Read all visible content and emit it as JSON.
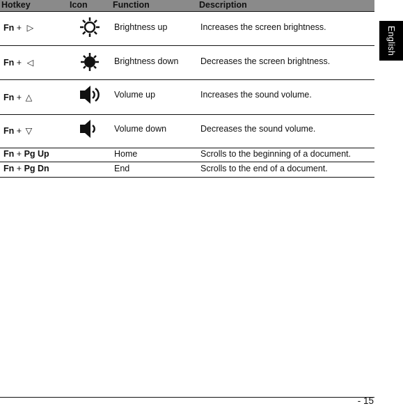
{
  "table": {
    "headers": {
      "hotkey": "Hotkey",
      "icon": "Icon",
      "function": "Function",
      "description": "Description"
    },
    "rows": [
      {
        "key": "Fn",
        "plus": "+",
        "key2": "▷",
        "icon": "brightness-up-icon",
        "function": "Brightness up",
        "description": "Increases the screen brightness."
      },
      {
        "key": "Fn",
        "plus": "+",
        "key2": "◁",
        "icon": "brightness-down-icon",
        "function": "Brightness down",
        "description": "Decreases the screen brightness."
      },
      {
        "key": "Fn",
        "plus": "+",
        "key2": "△",
        "icon": "volume-up-icon",
        "function": "Volume up",
        "description": "Increases the sound volume."
      },
      {
        "key": "Fn",
        "plus": "+",
        "key2": "▽",
        "icon": "volume-down-icon",
        "function": "Volume down",
        "description": "Decreases the sound volume."
      },
      {
        "key": "Fn",
        "plus": "+",
        "key2": "Pg Up",
        "icon": "",
        "function": "Home",
        "description": "Scrolls to the beginning of a document."
      },
      {
        "key": "Fn",
        "plus": "+",
        "key2": "Pg Dn",
        "icon": "",
        "function": "End",
        "description": "Scrolls to the end of a document."
      }
    ]
  },
  "side_tab": {
    "label": "English"
  },
  "footer": {
    "page_number": "- 15"
  }
}
